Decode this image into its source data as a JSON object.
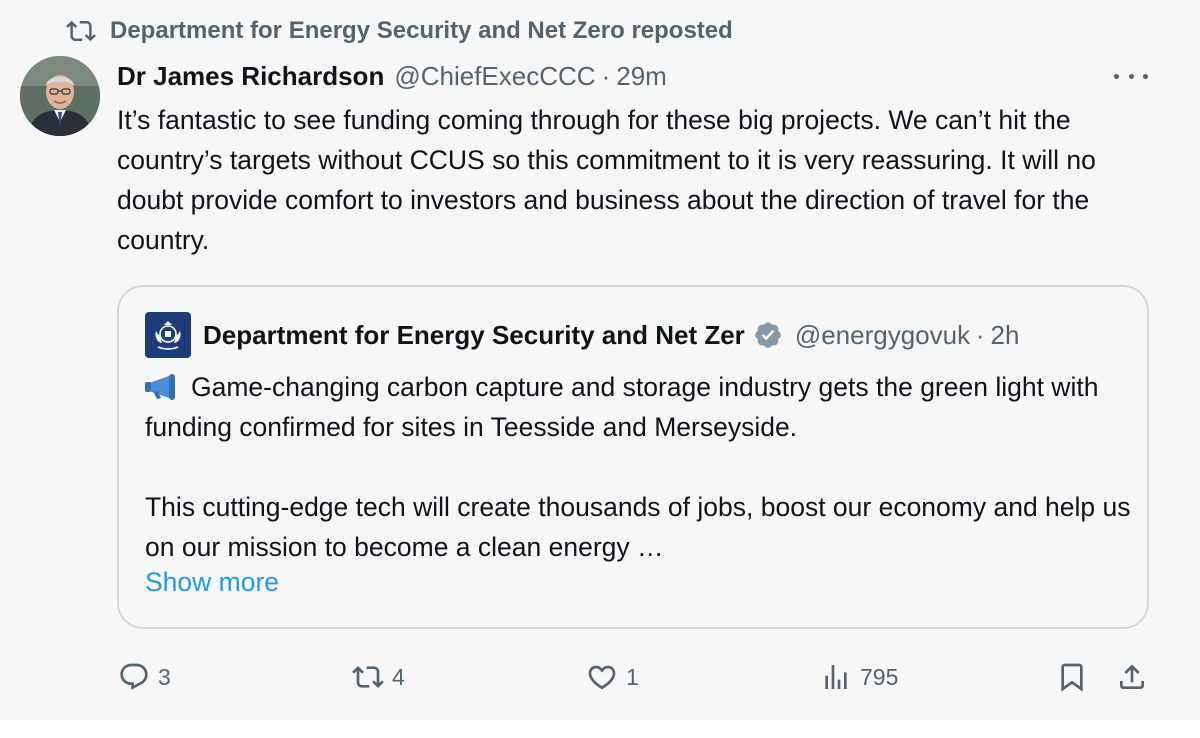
{
  "repost": {
    "icon": "repost-icon",
    "text": "Department for Energy Security and Net Zero reposted"
  },
  "tweet": {
    "avatar_icon": "avatar",
    "author_name": "Dr James Richardson",
    "handle": "@ChiefExecCCC",
    "separator": "·",
    "time": "29m",
    "more_icon": "more-icon",
    "text": "It’s fantastic to see funding coming through for these big projects. We can’t hit the country’s targets without CCUS so this commitment to it is very reassuring. It will no doubt provide comfort to investors and business about the direction of travel for the country."
  },
  "quote": {
    "logo_icon": "government-crest-icon",
    "author_name": "Department for Energy Security and Net Zer",
    "verified_icon": "verified-badge-icon",
    "handle": "@energygovuk",
    "separator": "·",
    "time": "2h",
    "megaphone_icon": "megaphone-icon",
    "paragraph1": "Game-changing carbon capture and storage industry gets the green light with funding confirmed for sites in Teesside and Merseyside.",
    "paragraph2": "This cutting-edge tech will create thousands of jobs, boost our economy and help us on our mission to become a clean energy …",
    "show_more": "Show more"
  },
  "actions": {
    "replies": "3",
    "reposts": "4",
    "likes": "1",
    "views": "795"
  },
  "colors": {
    "text_primary": "#0f1419",
    "text_secondary": "#536471",
    "link": "#1d9bf0",
    "background": "#f7f7f7",
    "border": "#d4d7da",
    "crest_background": "#1d3d78"
  }
}
